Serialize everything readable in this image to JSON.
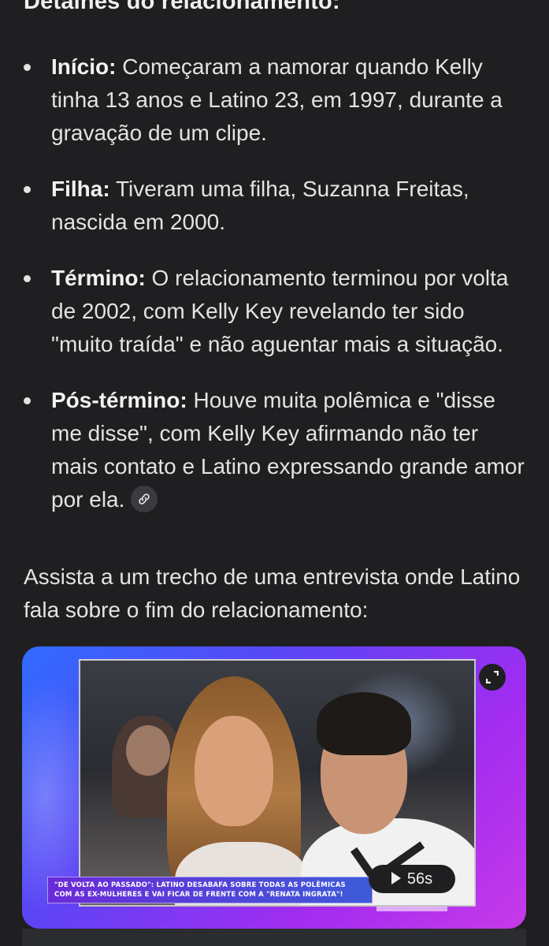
{
  "heading": "Detalhes do relacionamento:",
  "bullets": [
    {
      "term": "Início:",
      "text": " Começaram a namorar quando Kelly tinha 13 anos e Latino 23, em 1997, durante a gravação de um clipe."
    },
    {
      "term": "Filha:",
      "text": " Tiveram uma filha, Suzanna Freitas, nascida em 2000."
    },
    {
      "term": "Término:",
      "text": " O relacionamento terminou por volta de 2002, com Kelly Key revelando ter sido \"muito traída\" e não aguentar mais a situação."
    },
    {
      "term": "Pós-término:",
      "text": " Houve muita polêmica e \"disse me disse\", com Kelly Key afirmando não ter mais contato e Latino expressando grande amor por ela."
    }
  ],
  "link_icon": "link-icon",
  "intro": "Assista a um trecho de uma entrevista onde Latino fala sobre o fim do relacionamento:",
  "video": {
    "caption": "\"DE VOLTA AO PASSADO\": LATINO DESABAFA SOBRE TODAS AS POLÊMICAS COM AS EX-MULHERES E VAI FICAR DE FRENTE COM A \"RENATA INGRATA\"!",
    "duration": "56s",
    "expand_icon": "expand-icon",
    "play_icon": "play-icon",
    "accent_colors": [
      "#2f6bff",
      "#a22cf0"
    ]
  }
}
